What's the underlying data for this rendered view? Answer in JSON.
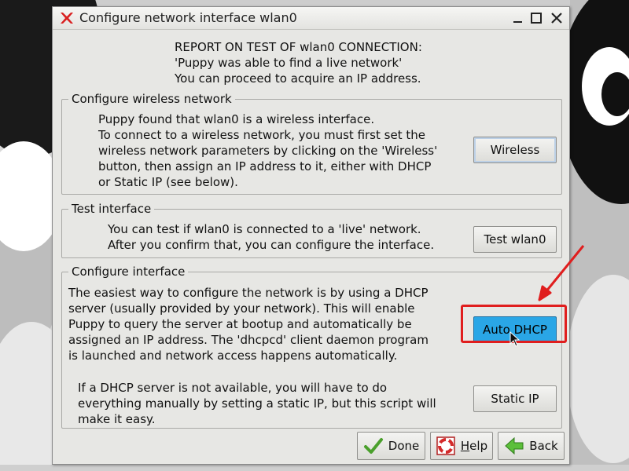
{
  "window": {
    "title": "Configure network interface wlan0"
  },
  "report": {
    "lines": [
      "REPORT ON TEST OF wlan0 CONNECTION:",
      "'Puppy was able to find a live network'",
      "You can proceed to acquire an IP address."
    ]
  },
  "wireless_frame": {
    "label": "Configure wireless network",
    "lines": [
      "Puppy found that wlan0 is a wireless interface.",
      "To connect to a wireless network, you must first set the",
      "wireless network parameters by clicking on the 'Wireless'",
      "button, then assign an IP address to it, either with DHCP",
      "or Static IP (see below)."
    ],
    "button": "Wireless"
  },
  "test_frame": {
    "label": "Test interface",
    "lines": [
      "You can test if wlan0 is connected to a 'live' network.",
      "After you confirm that, you can configure the interface."
    ],
    "button": "Test wlan0"
  },
  "configure_frame": {
    "label": "Configure interface",
    "dhcp_lines": [
      "The easiest way to configure the network is by using a DHCP",
      "server (usually provided by your network). This will enable",
      "Puppy to query the server at bootup and automatically be",
      "assigned an IP address. The 'dhcpcd' client daemon program",
      "is launched and network access happens automatically."
    ],
    "dhcp_button": "Auto DHCP",
    "static_lines": [
      "If a DHCP server is not available, you will have to do",
      "everything manually by setting a static IP, but this script will",
      "make it easy."
    ],
    "static_button": "Static IP"
  },
  "footer": {
    "done": "Done",
    "help_first": "H",
    "help_rest": "elp",
    "back": "Back"
  },
  "colors": {
    "highlight": "#e01e1e",
    "auto_dhcp_bg": "#2aa6e6"
  }
}
